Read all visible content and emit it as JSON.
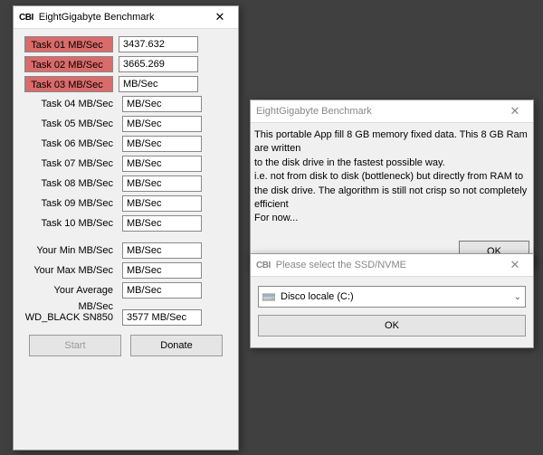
{
  "main": {
    "logo": "CBI",
    "title": "EightGigabyte Benchmark",
    "rows": [
      {
        "label": "Task 01 MB/Sec",
        "value": "3437.632",
        "hl": true
      },
      {
        "label": "Task 02 MB/Sec",
        "value": "3665.269",
        "hl": true
      },
      {
        "label": "Task 03 MB/Sec",
        "value": "MB/Sec",
        "hl": true
      },
      {
        "label": "Task 04 MB/Sec",
        "value": "MB/Sec",
        "hl": false
      },
      {
        "label": "Task 05 MB/Sec",
        "value": "MB/Sec",
        "hl": false
      },
      {
        "label": "Task 06 MB/Sec",
        "value": "MB/Sec",
        "hl": false
      },
      {
        "label": "Task 07 MB/Sec",
        "value": "MB/Sec",
        "hl": false
      },
      {
        "label": "Task 08 MB/Sec",
        "value": "MB/Sec",
        "hl": false
      },
      {
        "label": "Task 09 MB/Sec",
        "value": "MB/Sec",
        "hl": false
      },
      {
        "label": "Task 10 MB/Sec",
        "value": "MB/Sec",
        "hl": false
      }
    ],
    "summary": [
      {
        "label": "Your Min MB/Sec",
        "value": "MB/Sec"
      },
      {
        "label": "Your Max MB/Sec",
        "value": "MB/Sec"
      },
      {
        "label": "Your Average MB/Sec",
        "value": "MB/Sec"
      }
    ],
    "drive": {
      "label": "WD_BLACK SN850",
      "value": "3577 MB/Sec"
    },
    "start": "Start",
    "donate": "Donate"
  },
  "info": {
    "title": "EightGigabyte Benchmark",
    "line1": "This portable App fill 8 GB memory fixed data. This 8 GB Ram are written",
    "line2": "to the disk drive in the fastest possible way.",
    "line3": "i.e. not from disk to disk (bottleneck) but directly from RAM to",
    "line4": "the disk drive. The algorithm is still not crisp so not completely efficient",
    "line5": "For now...",
    "ok": "OK"
  },
  "selector": {
    "logo": "CBI",
    "title": "Please select the SSD/NVME",
    "option": "Disco locale (C:)",
    "ok": "OK"
  }
}
